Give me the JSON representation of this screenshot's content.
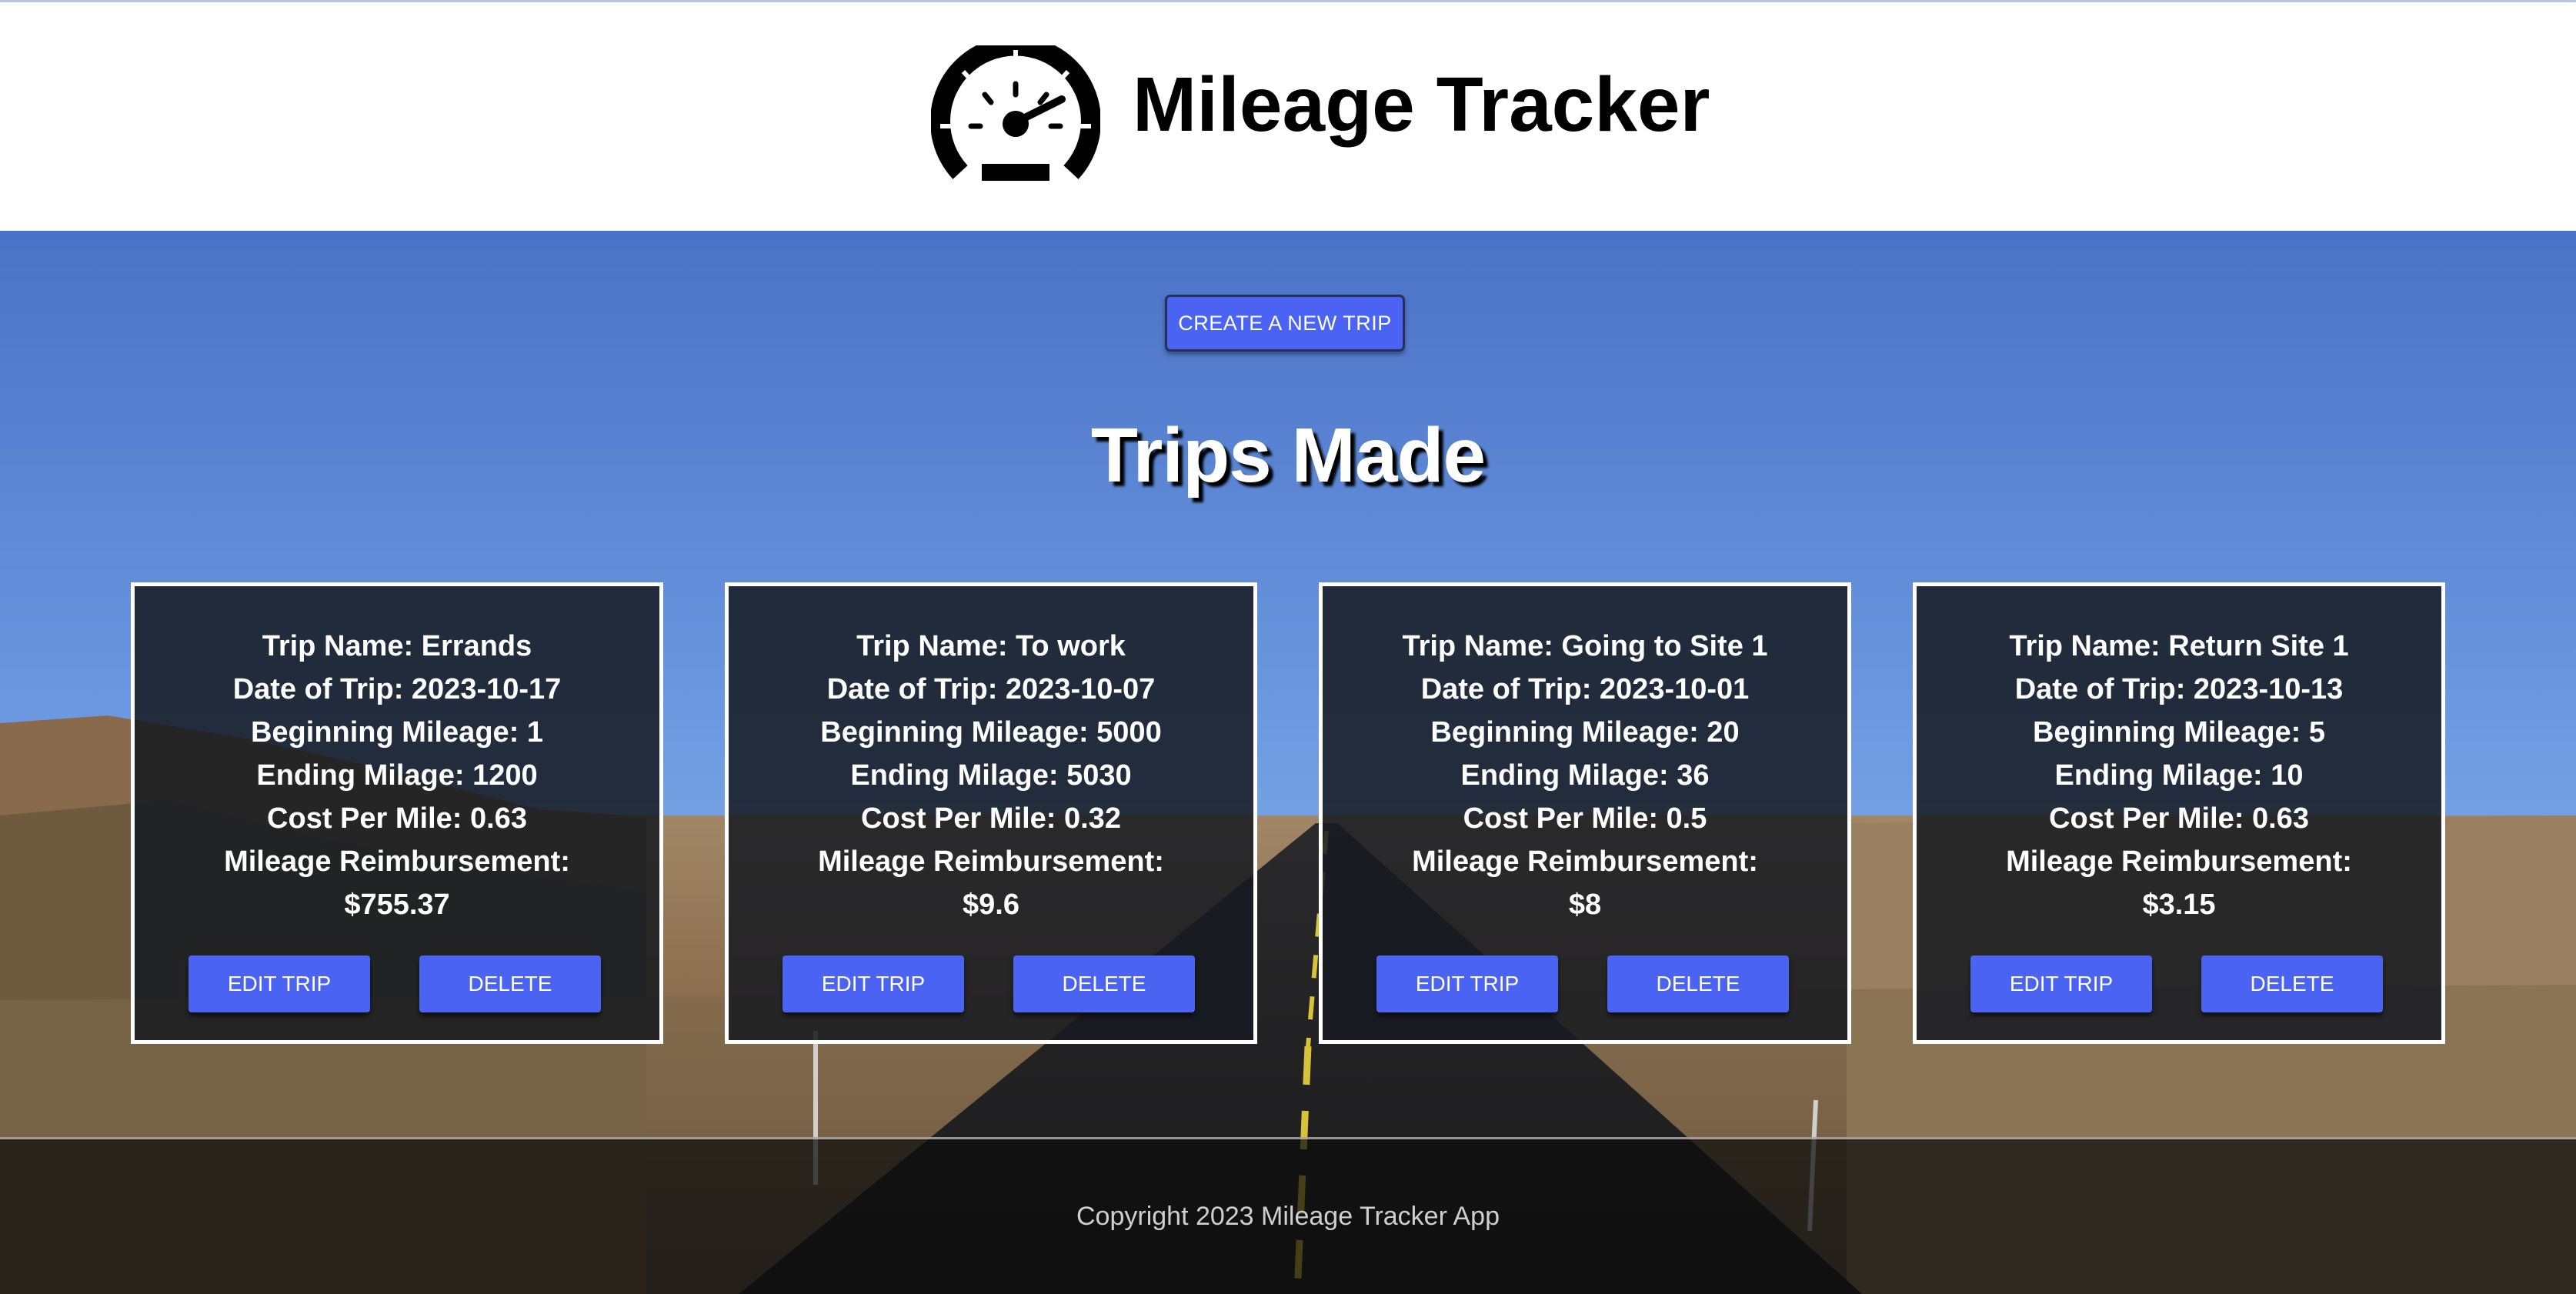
{
  "app": {
    "title": "Mileage Tracker",
    "logo_icon": "speedometer-icon"
  },
  "actions": {
    "create_label": "CREATE A NEW TRIP"
  },
  "section": {
    "title": "Trips Made"
  },
  "trips": [
    {
      "name_line": "Trip Name: Errands",
      "date_line": "Date of Trip: 2023-10-17",
      "begin_line": "Beginning Mileage: 1",
      "end_line": "Ending Milage: 1200",
      "cost_line": "Cost Per Mile: 0.63",
      "reimb_label": "Mileage Reimbursement:",
      "reimb_value": "$755.37",
      "edit_label": "EDIT TRIP",
      "delete_label": "DELETE"
    },
    {
      "name_line": "Trip Name: To work",
      "date_line": "Date of Trip: 2023-10-07",
      "begin_line": "Beginning Mileage: 5000",
      "end_line": "Ending Milage: 5030",
      "cost_line": "Cost Per Mile: 0.32",
      "reimb_label": "Mileage Reimbursement:",
      "reimb_value": "$9.6",
      "edit_label": "EDIT TRIP",
      "delete_label": "DELETE"
    },
    {
      "name_line": "Trip Name: Going to Site 1",
      "date_line": "Date of Trip: 2023-10-01",
      "begin_line": "Beginning Mileage: 20",
      "end_line": "Ending Milage: 36",
      "cost_line": "Cost Per Mile: 0.5",
      "reimb_label": "Mileage Reimbursement:",
      "reimb_value": "$8",
      "edit_label": "EDIT TRIP",
      "delete_label": "DELETE"
    },
    {
      "name_line": "Trip Name: Return Site 1",
      "date_line": "Date of Trip: 2023-10-13",
      "begin_line": "Beginning Mileage: 5",
      "end_line": "Ending Milage: 10",
      "cost_line": "Cost Per Mile: 0.63",
      "reimb_label": "Mileage Reimbursement:",
      "reimb_value": "$3.15",
      "edit_label": "EDIT TRIP",
      "delete_label": "DELETE"
    }
  ],
  "footer": {
    "copyright": "Copyright 2023 Mileage Tracker App"
  },
  "colors": {
    "accent": "#4a63f3",
    "sky_top": "#4a72c6",
    "sky_bottom": "#8ab6ea",
    "card_bg": "#161a21"
  }
}
